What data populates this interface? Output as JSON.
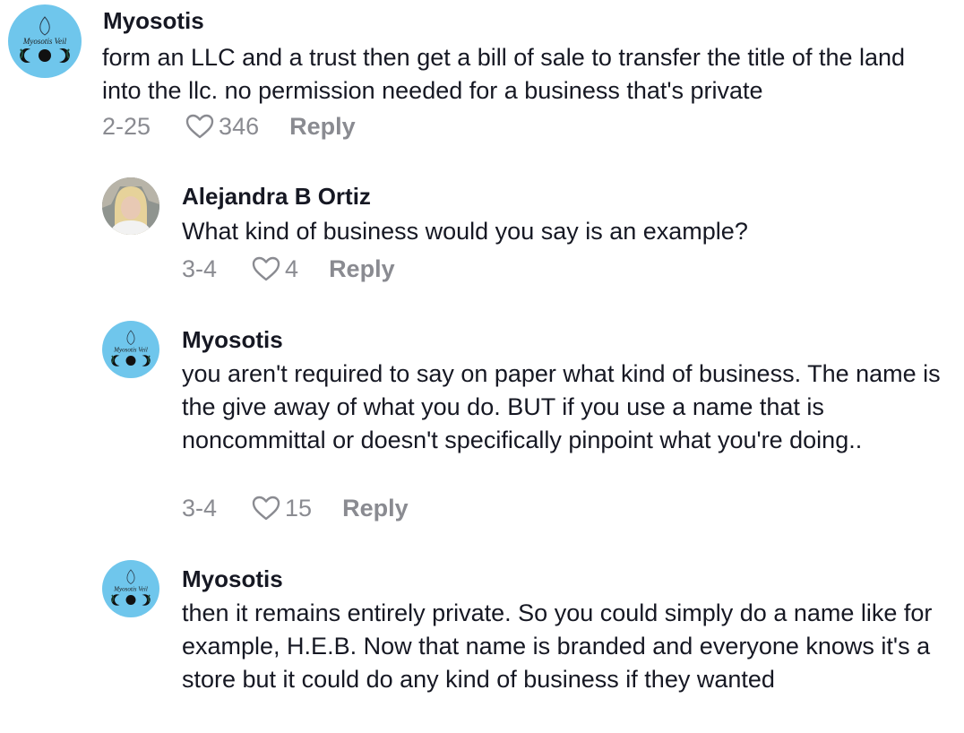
{
  "comments": [
    {
      "author": "Myosotis",
      "avatar_icon": "myosotis-veil-logo",
      "avatar_logo_text": "Myosotis Veil",
      "text": "form an LLC and a trust then get a bill of sale to transfer the title of the land into the llc. no permission needed for a business that's private",
      "date": "2-25",
      "likes": "346",
      "reply_label": "Reply"
    },
    {
      "author": "Alejandra B Ortiz",
      "avatar_icon": "user-photo",
      "text": "What kind of business would you say is an example?",
      "date": "3-4",
      "likes": "4",
      "reply_label": "Reply"
    },
    {
      "author": "Myosotis",
      "avatar_icon": "myosotis-veil-logo",
      "avatar_logo_text": "Myosotis Veil",
      "text": "you aren't required to say on paper what kind of business. The name is the give away of what you do. BUT if you use a name that is noncommittal or doesn't specifically pinpoint what you're doing..",
      "date": "3-4",
      "likes": "15",
      "reply_label": "Reply"
    },
    {
      "author": "Myosotis",
      "avatar_icon": "myosotis-veil-logo",
      "avatar_logo_text": "Myosotis Veil",
      "text": "then it remains entirely private. So you could simply do a name like for example, H.E.B. Now that name is branded and everyone knows it's a store but it could do any kind of business if they wanted"
    }
  ],
  "colors": {
    "text": "#161823",
    "meta": "#8a8b91",
    "brand_avatar_bg": "#6fc6ec"
  }
}
